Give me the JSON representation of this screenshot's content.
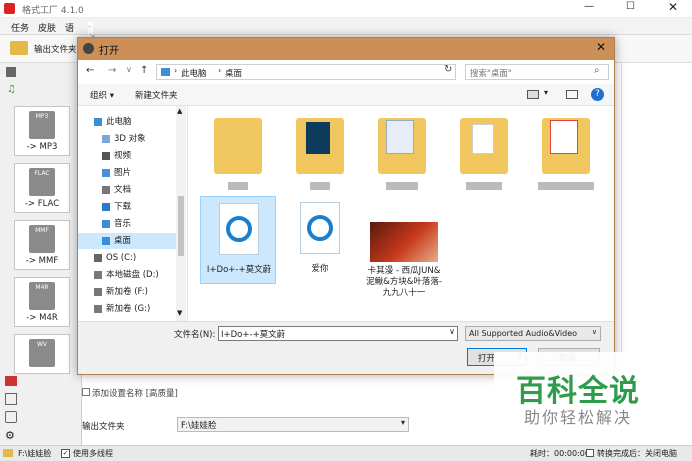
{
  "app": {
    "title": "格式工厂 4.1.0",
    "menu": [
      "任务",
      "皮肤",
      "语"
    ],
    "output_folder_btn": "输出文件夹",
    "task_header": "-> MP3",
    "formats": [
      {
        "label": "-> MP3",
        "icon": "MP3"
      },
      {
        "label": "-> FLAC",
        "icon": "FLAC"
      },
      {
        "label": "-> MMF",
        "icon": "MMF"
      },
      {
        "label": "-> M4R",
        "icon": "M4R"
      },
      {
        "label": "-> WV",
        "icon": "WV"
      }
    ],
    "add_setting_name": "添加设置名称 [高质量]",
    "output_folder_label": "输出文件夹",
    "output_folder_value": "F:\\娃娃脸",
    "status_path": "F:\\娃娃脸",
    "use_multithread": "使用多线程",
    "elapsed": "耗时：00:00:00",
    "after_convert": "转换完成后：关闭电脑"
  },
  "dialog": {
    "title": "打开",
    "address": [
      "此电脑",
      "桌面"
    ],
    "search_placeholder": "搜索\"桌面\"",
    "organize": "组织 ▾",
    "new_folder": "新建文件夹",
    "tree": [
      "此电脑",
      "3D 对象",
      "视频",
      "图片",
      "文档",
      "下载",
      "音乐",
      "桌面",
      "OS (C:)",
      "本地磁盘 (D:)",
      "新加卷 (F:)",
      "新加卷 (G:)"
    ],
    "files": [
      {
        "name": "I+Do+-+莫文蔚",
        "type": "audio"
      },
      {
        "name": "爱你",
        "type": "audio"
      },
      {
        "name": "卡其漫 - 西瓜JUN&泥鳅&方块&叶落落-九九八十一",
        "type": "image"
      }
    ],
    "filename_label": "文件名(N):",
    "filename_value": "I+Do+-+莫文蔚",
    "filetype": "All Supported Audio&Video",
    "open_btn": "打开",
    "cancel_btn": "取消"
  },
  "watermark": {
    "main": "百科全说",
    "sub": "助你轻松解决"
  },
  "colors": {
    "dialog_title": "#cb8f57",
    "watermark": "#2f9c4c",
    "selected": "#cce8ff"
  }
}
